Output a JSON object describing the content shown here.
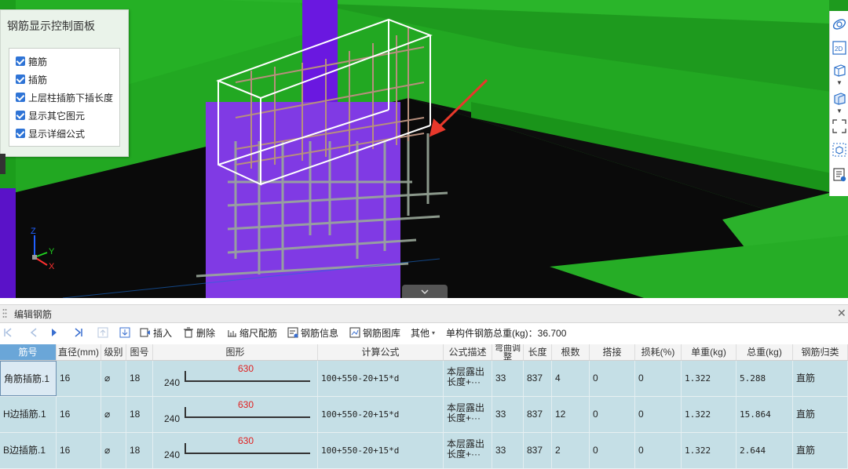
{
  "control_panel": {
    "title": "钢筋显示控制面板",
    "options": [
      {
        "label": "箍筋",
        "checked": true
      },
      {
        "label": "插筋",
        "checked": true
      },
      {
        "label": "上层柱插筋下插长度",
        "checked": true
      },
      {
        "label": "显示其它图元",
        "checked": true
      },
      {
        "label": "显示详细公式",
        "checked": true
      }
    ]
  },
  "axes": {
    "x": "X",
    "y": "Y",
    "z": "Z"
  },
  "right_toolbar": {
    "view_2d_label": "2D"
  },
  "panel": {
    "title": "编辑钢筋",
    "toolbar": {
      "insert": "插入",
      "delete": "删除",
      "scale_rebar": "缩尺配筋",
      "rebar_info": "钢筋信息",
      "rebar_library": "钢筋图库",
      "other": "其他",
      "total_weight": "单构件钢筋总重(kg)：36.700"
    },
    "columns": [
      "筋号",
      "直径(mm)",
      "级别",
      "图号",
      "图形",
      "计算公式",
      "公式描述",
      "弯曲调整",
      "长度",
      "根数",
      "搭接",
      "损耗(%)",
      "单重(kg)",
      "总重(kg)",
      "钢筋归类"
    ],
    "rows": [
      {
        "name": "角筋插筋.1",
        "diameter": "16",
        "grade": "⌀",
        "fig": "18",
        "shape_left": "240",
        "shape_top": "630",
        "formula": "100+550-20+15*d",
        "desc": "本层露出长度+···",
        "bend": "33",
        "length": "837",
        "count": "4",
        "lap": "0",
        "loss": "0",
        "unit_w": "1.322",
        "total_w": "5.288",
        "category": "直筋"
      },
      {
        "name": "H边插筋.1",
        "diameter": "16",
        "grade": "⌀",
        "fig": "18",
        "shape_left": "240",
        "shape_top": "630",
        "formula": "100+550-20+15*d",
        "desc": "本层露出长度+···",
        "bend": "33",
        "length": "837",
        "count": "12",
        "lap": "0",
        "loss": "0",
        "unit_w": "1.322",
        "total_w": "15.864",
        "category": "直筋"
      },
      {
        "name": "B边插筋.1",
        "diameter": "16",
        "grade": "⌀",
        "fig": "18",
        "shape_left": "240",
        "shape_top": "630",
        "formula": "100+550-20+15*d",
        "desc": "本层露出长度+···",
        "bend": "33",
        "length": "837",
        "count": "2",
        "lap": "0",
        "loss": "0",
        "unit_w": "1.322",
        "total_w": "2.644",
        "category": "直筋"
      }
    ]
  }
}
